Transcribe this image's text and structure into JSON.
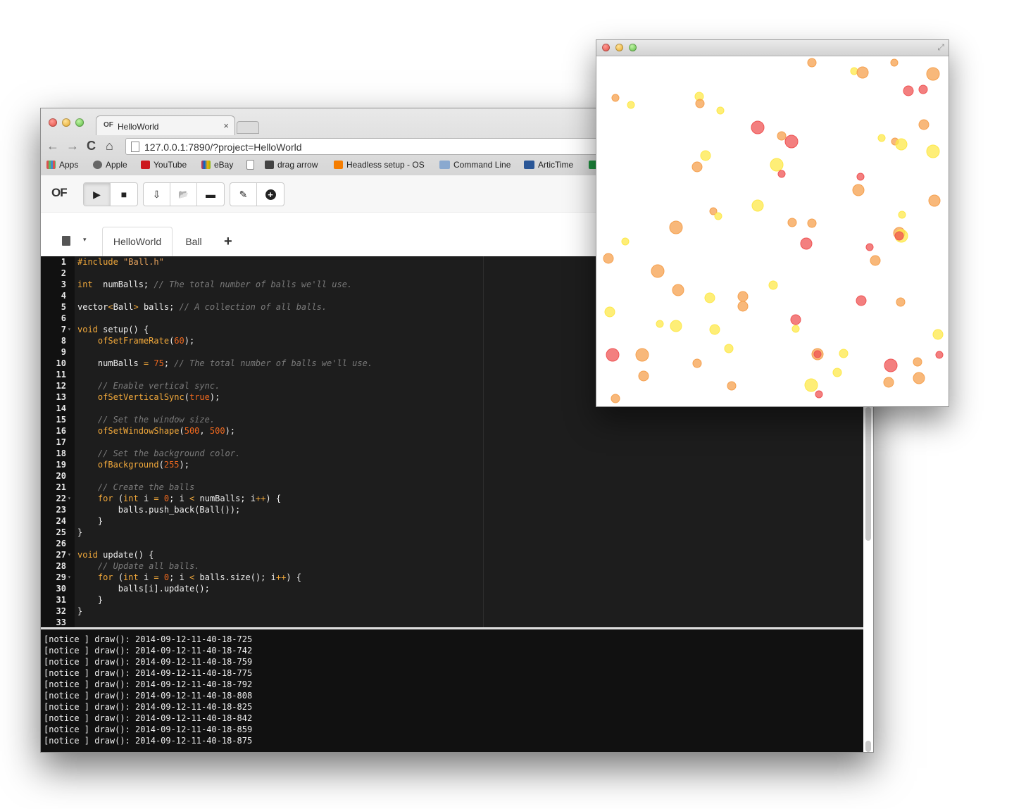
{
  "browser": {
    "tab_title": "HelloWorld",
    "tab_close": "×",
    "tab_favicon": "OF",
    "url": "127.0.0.1:7890/?project=HelloWorld",
    "nav": {
      "back": "←",
      "forward": "→",
      "reload": "C",
      "home": "⌂"
    },
    "bookmarks": [
      {
        "label": "Apps",
        "icon": "apps-grid-icon",
        "color": "#d9534f"
      },
      {
        "label": "Apple",
        "icon": "apple-icon",
        "color": "#555555"
      },
      {
        "label": "YouTube",
        "icon": "youtube-icon",
        "color": "#cc181e"
      },
      {
        "label": "eBay",
        "icon": "ebay-icon",
        "color": "#2b7bb9"
      },
      {
        "label": "",
        "icon": "document-icon",
        "color": "#ffffff"
      },
      {
        "label": "drag arrow",
        "icon": "arrow-icon",
        "color": "#444444"
      },
      {
        "label": "Headless setup - OS",
        "icon": "blogger-icon",
        "color": "#f57d00"
      },
      {
        "label": "Command Line",
        "icon": "folder-icon",
        "color": "#8aa9cf"
      },
      {
        "label": "ArticTime",
        "icon": "w-logo-icon",
        "color": "#2b5797"
      }
    ]
  },
  "toolbar": {
    "logo": "OF",
    "buttons": {
      "play": "▶",
      "stop": "■",
      "save": "⇩",
      "open": "📂",
      "folder": "▬",
      "attach": "✎",
      "add": "+"
    }
  },
  "file_tabs": {
    "tabs": [
      "HelloWorld",
      "Ball"
    ],
    "active": "HelloWorld",
    "plus": "+",
    "caret": "▾"
  },
  "editor": {
    "lines": [
      {
        "n": "1",
        "tokens": [
          [
            "kw",
            "#include "
          ],
          [
            "str",
            "\"Ball.h\""
          ]
        ]
      },
      {
        "n": "2",
        "tokens": []
      },
      {
        "n": "3",
        "tokens": [
          [
            "kw",
            "int"
          ],
          [
            "",
            "  numBalls; "
          ],
          [
            "cm",
            "// The total number of balls we'll use."
          ]
        ]
      },
      {
        "n": "4",
        "tokens": []
      },
      {
        "n": "5",
        "tokens": [
          [
            "",
            "vector"
          ],
          [
            "kw",
            "<"
          ],
          [
            "",
            "Ball"
          ],
          [
            "kw",
            ">"
          ],
          [
            "",
            " balls; "
          ],
          [
            "cm",
            "// A collection of all balls."
          ]
        ]
      },
      {
        "n": "6",
        "tokens": []
      },
      {
        "n": "7",
        "fold": true,
        "tokens": [
          [
            "kw",
            "void"
          ],
          [
            "",
            " setup() {"
          ]
        ]
      },
      {
        "n": "8",
        "tokens": [
          [
            "",
            "    "
          ],
          [
            "fn",
            "ofSetFrameRate"
          ],
          [
            "",
            "("
          ],
          [
            "num",
            "60"
          ],
          [
            "",
            ");"
          ]
        ]
      },
      {
        "n": "9",
        "tokens": []
      },
      {
        "n": "10",
        "tokens": [
          [
            "",
            "    numBalls "
          ],
          [
            "kw",
            "="
          ],
          [
            "",
            " "
          ],
          [
            "num",
            "75"
          ],
          [
            "",
            "; "
          ],
          [
            "cm",
            "// The total number of balls we'll use."
          ]
        ]
      },
      {
        "n": "11",
        "tokens": []
      },
      {
        "n": "12",
        "tokens": [
          [
            "",
            "    "
          ],
          [
            "cm",
            "// Enable vertical sync."
          ]
        ]
      },
      {
        "n": "13",
        "tokens": [
          [
            "",
            "    "
          ],
          [
            "fn",
            "ofSetVerticalSync"
          ],
          [
            "",
            "("
          ],
          [
            "num",
            "true"
          ],
          [
            "",
            ");"
          ]
        ]
      },
      {
        "n": "14",
        "tokens": []
      },
      {
        "n": "15",
        "tokens": [
          [
            "",
            "    "
          ],
          [
            "cm",
            "// Set the window size."
          ]
        ]
      },
      {
        "n": "16",
        "tokens": [
          [
            "",
            "    "
          ],
          [
            "fn",
            "ofSetWindowShape"
          ],
          [
            "",
            "("
          ],
          [
            "num",
            "500"
          ],
          [
            "",
            ", "
          ],
          [
            "num",
            "500"
          ],
          [
            "",
            ");"
          ]
        ]
      },
      {
        "n": "17",
        "tokens": []
      },
      {
        "n": "18",
        "tokens": [
          [
            "",
            "    "
          ],
          [
            "cm",
            "// Set the background color."
          ]
        ]
      },
      {
        "n": "19",
        "tokens": [
          [
            "",
            "    "
          ],
          [
            "fn",
            "ofBackground"
          ],
          [
            "",
            "("
          ],
          [
            "num",
            "255"
          ],
          [
            "",
            ");"
          ]
        ]
      },
      {
        "n": "20",
        "tokens": []
      },
      {
        "n": "21",
        "tokens": [
          [
            "",
            "    "
          ],
          [
            "cm",
            "// Create the balls"
          ]
        ]
      },
      {
        "n": "22",
        "fold": true,
        "tokens": [
          [
            "",
            "    "
          ],
          [
            "kw",
            "for"
          ],
          [
            "",
            " ("
          ],
          [
            "kw",
            "int"
          ],
          [
            "",
            " i "
          ],
          [
            "kw",
            "="
          ],
          [
            "",
            " "
          ],
          [
            "num",
            "0"
          ],
          [
            "",
            "; i "
          ],
          [
            "kw",
            "<"
          ],
          [
            "",
            " numBalls; i"
          ],
          [
            "kw",
            "++"
          ],
          [
            "",
            ") {"
          ]
        ]
      },
      {
        "n": "23",
        "tokens": [
          [
            "",
            "        balls.push_back(Ball());"
          ]
        ]
      },
      {
        "n": "24",
        "tokens": [
          [
            "",
            "    }"
          ]
        ]
      },
      {
        "n": "25",
        "tokens": [
          [
            "",
            "}"
          ]
        ]
      },
      {
        "n": "26",
        "tokens": []
      },
      {
        "n": "27",
        "fold": true,
        "tokens": [
          [
            "kw",
            "void"
          ],
          [
            "",
            " update() {"
          ]
        ]
      },
      {
        "n": "28",
        "tokens": [
          [
            "",
            "    "
          ],
          [
            "cm",
            "// Update all balls."
          ]
        ]
      },
      {
        "n": "29",
        "fold": true,
        "tokens": [
          [
            "",
            "    "
          ],
          [
            "kw",
            "for"
          ],
          [
            "",
            " ("
          ],
          [
            "kw",
            "int"
          ],
          [
            "",
            " i "
          ],
          [
            "kw",
            "="
          ],
          [
            "",
            " "
          ],
          [
            "num",
            "0"
          ],
          [
            "",
            "; i "
          ],
          [
            "kw",
            "<"
          ],
          [
            "",
            " balls.size(); i"
          ],
          [
            "kw",
            "++"
          ],
          [
            "",
            ") {"
          ]
        ]
      },
      {
        "n": "30",
        "tokens": [
          [
            "",
            "        balls[i].update();"
          ]
        ]
      },
      {
        "n": "31",
        "tokens": [
          [
            "",
            "    }"
          ]
        ]
      },
      {
        "n": "32",
        "tokens": [
          [
            "",
            "}"
          ]
        ]
      },
      {
        "n": "33",
        "tokens": []
      }
    ]
  },
  "console": {
    "lines": [
      "[notice ] draw(): 2014-09-12-11-40-18-725",
      "[notice ] draw(): 2014-09-12-11-40-18-742",
      "[notice ] draw(): 2014-09-12-11-40-18-759",
      "[notice ] draw(): 2014-09-12-11-40-18-775",
      "[notice ] draw(): 2014-09-12-11-40-18-792",
      "[notice ] draw(): 2014-09-12-11-40-18-808",
      "[notice ] draw(): 2014-09-12-11-40-18-825",
      "[notice ] draw(): 2014-09-12-11-40-18-842",
      "[notice ] draw(): 2014-09-12-11-40-18-859",
      "[notice ] draw(): 2014-09-12-11-40-18-875"
    ]
  },
  "output_window": {
    "resize_glyph": "⤢",
    "ball_colors": {
      "red": "#ef5454",
      "orange": "#f5a04e",
      "yellow": "#fde84a"
    }
  },
  "colors": {
    "editor_bg": "#1d1d1d",
    "keyword": "#f2a93b",
    "comment": "#7b7b7b",
    "number": "#f0691e"
  }
}
